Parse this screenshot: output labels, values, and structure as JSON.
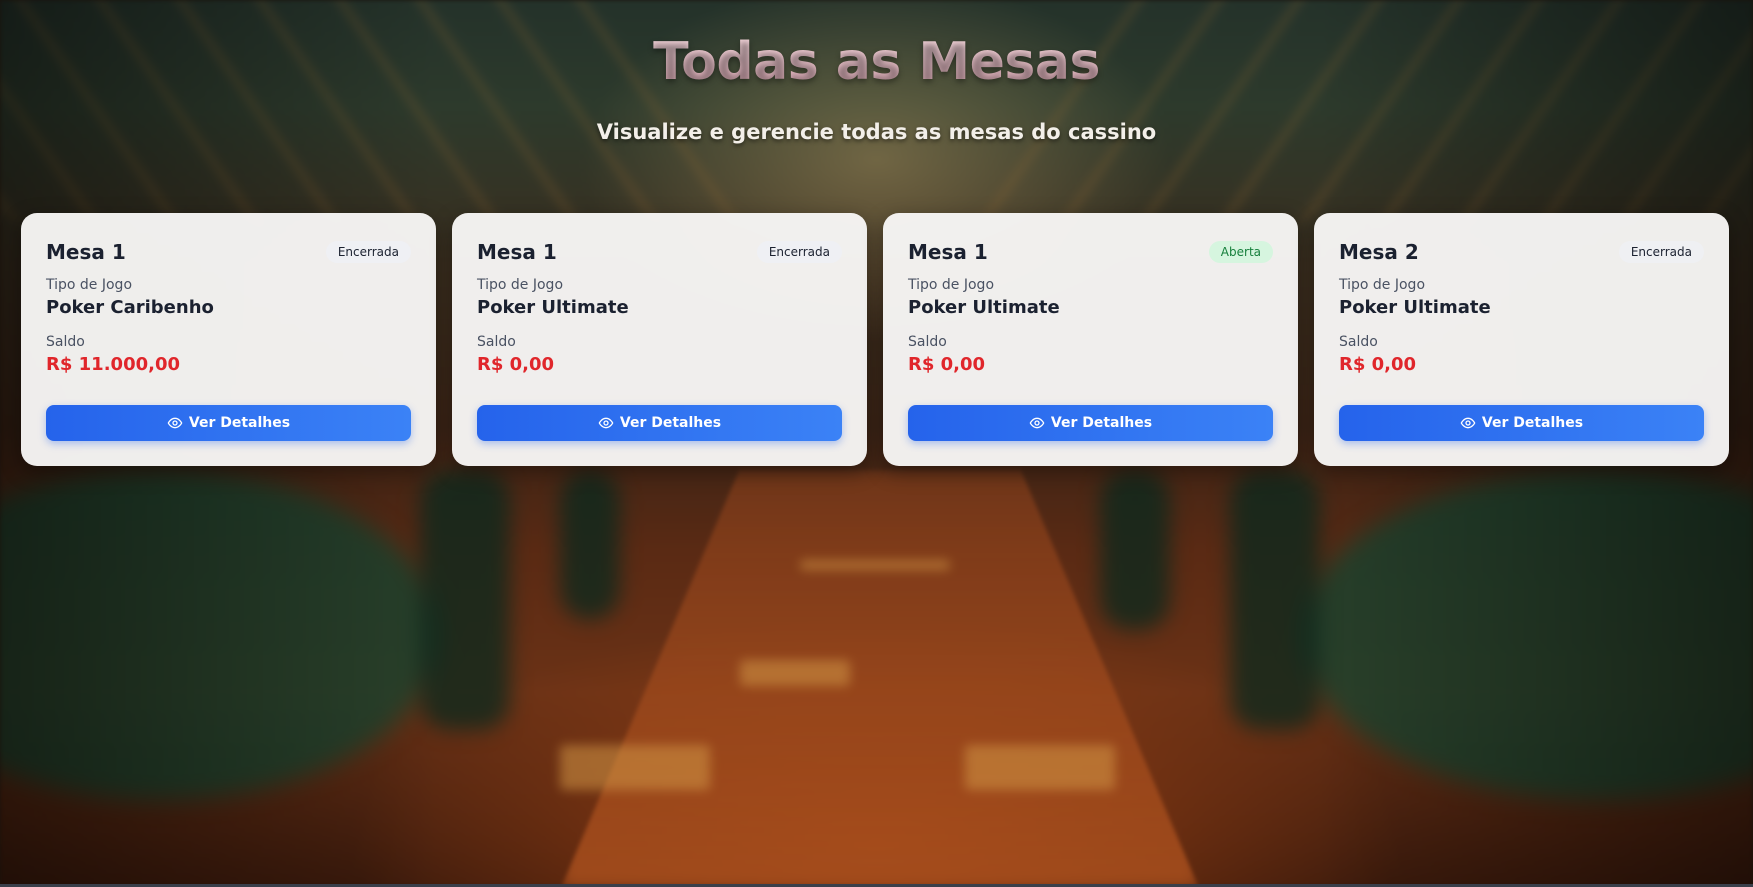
{
  "header": {
    "title": "Todas as Mesas",
    "subtitle": "Visualize e gerencie todas as mesas do cassino"
  },
  "cards": [
    {
      "name": "Mesa 1",
      "status": "Encerrada",
      "game_label": "Tipo de Jogo",
      "game": "Poker Caribenho",
      "balance_label": "Saldo",
      "balance": "R$ 11.000,00",
      "button_label": "Ver Detalhes",
      "button_icon": "eye-icon"
    },
    {
      "name": "Mesa 1",
      "status": "Encerrada",
      "game_label": "Tipo de Jogo",
      "game": "Poker Ultimate",
      "balance_label": "Saldo",
      "balance": "R$ 0,00",
      "button_label": "Ver Detalhes",
      "button_icon": "eye-icon"
    },
    {
      "name": "Mesa 1",
      "status": "Aberta",
      "game_label": "Tipo de Jogo",
      "game": "Poker Ultimate",
      "balance_label": "Saldo",
      "balance": "R$ 0,00",
      "button_label": "Ver Detalhes",
      "button_icon": "eye-icon"
    },
    {
      "name": "Mesa 2",
      "status": "Encerrada",
      "game_label": "Tipo de Jogo",
      "game": "Poker Ultimate",
      "balance_label": "Saldo",
      "balance": "R$ 0,00",
      "button_label": "Ver Detalhes",
      "button_icon": "eye-icon"
    }
  ],
  "colors": {
    "balance": "#e0262b",
    "button": "#2563eb",
    "status_open_bg": "#d6f5df",
    "status_open_text": "#17803d",
    "title": "#e8c1c8"
  }
}
